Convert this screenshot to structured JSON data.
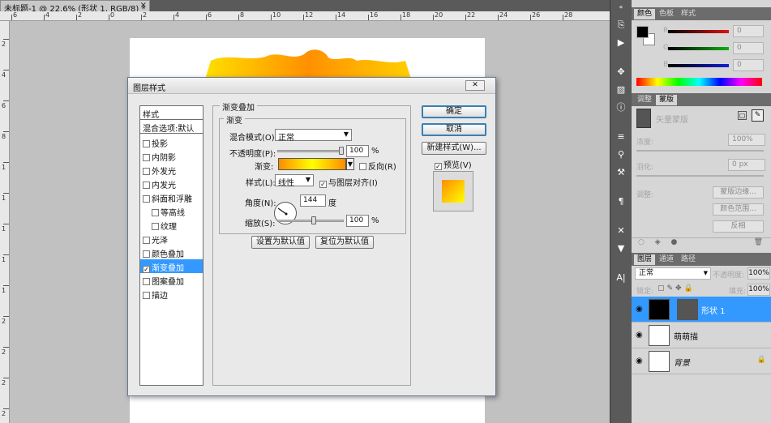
{
  "doc": {
    "tab_title": "未标题-1 @ 22.6% (形状 1, RGB/8) *",
    "close": "×"
  },
  "ruler": {
    "top_labels": [
      "6",
      "4",
      "2",
      "0",
      "2",
      "4",
      "6",
      "8",
      "10",
      "12",
      "14",
      "16",
      "18",
      "20",
      "22",
      "24",
      "26",
      "28"
    ],
    "left_labels": [
      "2",
      "4",
      "6",
      "8",
      "1",
      "1",
      "1",
      "1",
      "1",
      "2",
      "2",
      "2",
      "2"
    ]
  },
  "dialog": {
    "title": "图层样式",
    "close": "✕",
    "style_list": {
      "header": "样式",
      "blend_options": "混合选项:默认",
      "items": [
        {
          "label": "投影",
          "checked": false,
          "sub": false
        },
        {
          "label": "内阴影",
          "checked": false,
          "sub": false
        },
        {
          "label": "外发光",
          "checked": false,
          "sub": false
        },
        {
          "label": "内发光",
          "checked": false,
          "sub": false
        },
        {
          "label": "斜面和浮雕",
          "checked": false,
          "sub": false
        },
        {
          "label": "等高线",
          "checked": false,
          "sub": true
        },
        {
          "label": "纹理",
          "checked": false,
          "sub": true
        },
        {
          "label": "光泽",
          "checked": false,
          "sub": false
        },
        {
          "label": "颜色叠加",
          "checked": false,
          "sub": false
        },
        {
          "label": "渐变叠加",
          "checked": true,
          "sub": false,
          "selected": true
        },
        {
          "label": "图案叠加",
          "checked": false,
          "sub": false
        },
        {
          "label": "描边",
          "checked": false,
          "sub": false
        }
      ]
    },
    "group_title": "渐变叠加",
    "subgroup_title": "渐变",
    "blend_mode_label": "混合模式(O):",
    "blend_mode_value": "正常",
    "opacity_label": "不透明度(P):",
    "opacity_value": "100",
    "percent": "%",
    "gradient_label": "渐变:",
    "reverse_label": "反向(R)",
    "style_label": "样式(L):",
    "style_value": "线性",
    "align_label": "与图层对齐(I)",
    "angle_label": "角度(N):",
    "angle_value": "144",
    "degree_unit": "度",
    "scale_label": "缩放(S):",
    "scale_value": "100",
    "set_default": "设置为默认值",
    "reset_default": "复位为默认值",
    "ok": "确定",
    "cancel": "取消",
    "new_style": "新建样式(W)...",
    "preview_label": "预览(V)"
  },
  "panels": {
    "color_tabs": [
      "颜色",
      "色板",
      "样式"
    ],
    "color_channels": [
      {
        "label": "R",
        "value": "0",
        "color": "#e01010"
      },
      {
        "label": "G",
        "value": "0",
        "color": "#10b010"
      },
      {
        "label": "B",
        "value": "0",
        "color": "#1020d0"
      }
    ],
    "adjust_tabs": [
      "调整",
      "蒙版"
    ],
    "mask_title": "矢量蒙版",
    "density_label": "浓度:",
    "density_value": "100%",
    "feather_label": "羽化:",
    "feather_value": "0 px",
    "adjust_label": "调整:",
    "mask_edge": "蒙版边缘...",
    "color_range": "颜色范围...",
    "invert": "反相",
    "layers_tabs": [
      "图层",
      "通道",
      "路径"
    ],
    "blend_mode": "正常",
    "opacity_label": "不透明度:",
    "opacity_value": "100%",
    "lock_label": "锁定:",
    "fill_label": "填充:",
    "fill_value": "100%",
    "layers": [
      {
        "name": "形状 1",
        "selected": true
      },
      {
        "name": "萌萌描",
        "selected": false
      },
      {
        "name": "背景",
        "selected": false
      }
    ]
  }
}
